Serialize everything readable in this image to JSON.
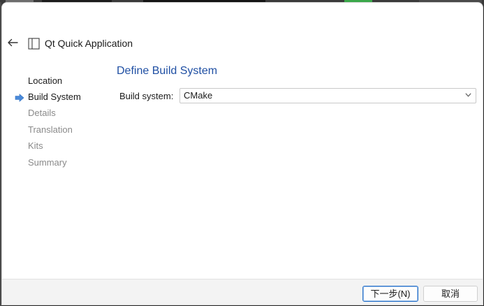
{
  "window": {
    "title": "Qt Quick Application",
    "back_icon": "arrow-left-icon",
    "app_icon": "qt-wizard-icon"
  },
  "sidebar": {
    "steps": [
      {
        "label": "Location",
        "state": "done"
      },
      {
        "label": "Build System",
        "state": "current"
      },
      {
        "label": "Details",
        "state": "future"
      },
      {
        "label": "Translation",
        "state": "future"
      },
      {
        "label": "Kits",
        "state": "future"
      },
      {
        "label": "Summary",
        "state": "future"
      }
    ],
    "current_marker_color": "#4a8ad9"
  },
  "page": {
    "title": "Define Build System",
    "build_system_label": "Build system:",
    "build_system_value": "CMake"
  },
  "footer": {
    "next_label": "下一步(N)",
    "cancel_label": "取消"
  },
  "colors": {
    "accent": "#1f4fa3",
    "focus_border": "#2a72c9"
  }
}
